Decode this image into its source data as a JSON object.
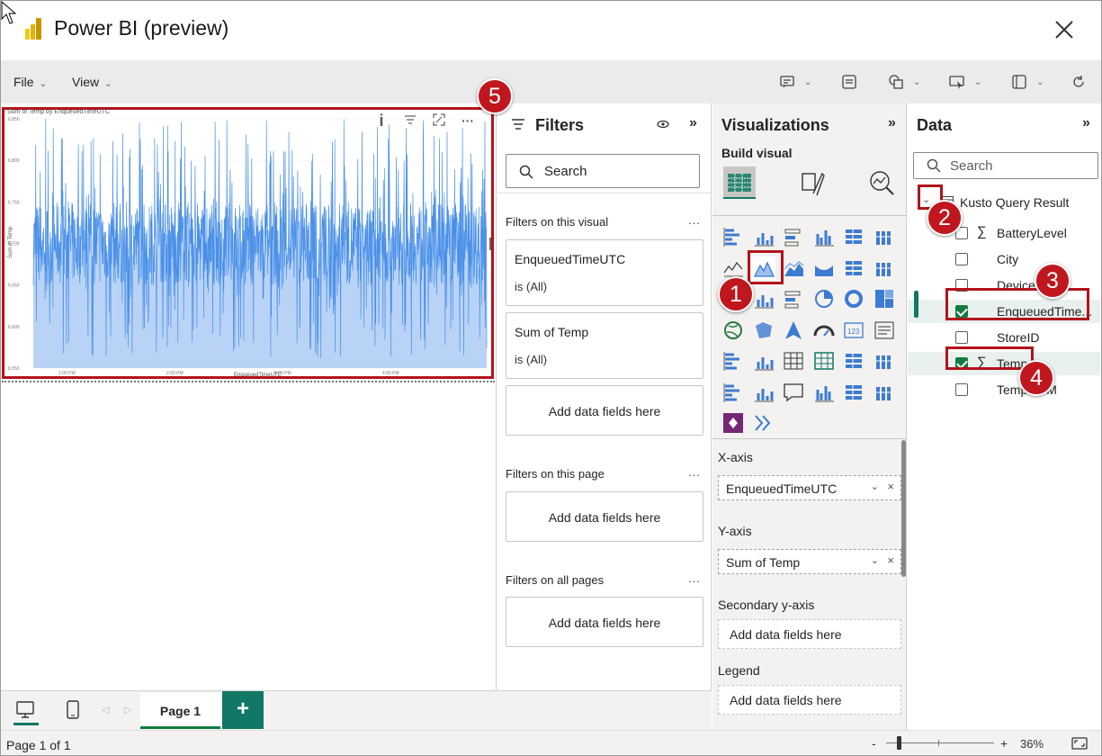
{
  "window": {
    "title": "Power BI (preview)"
  },
  "menu": {
    "file": "File",
    "view": "View"
  },
  "visual": {
    "title": "Sum of Temp by EnqueuedTimeUTC",
    "info_icon": "i",
    "more": "···"
  },
  "chart_data": {
    "type": "area",
    "title": "Sum of Temp by EnqueuedTimeUTC",
    "xlabel": "EnqueuedTimeUTC",
    "ylabel": "Sum of Temp",
    "x_ticks": [
      "1:00 PM",
      "2:00 PM",
      "3:00 PM",
      "4:00 PM"
    ],
    "y_ticks": [
      "6,550",
      "6,600",
      "6,650",
      "6,700",
      "6,750",
      "6,800",
      "6,850"
    ],
    "ylim": [
      6550,
      6850
    ],
    "series": [
      {
        "name": "Sum of Temp",
        "color": "#4a90e8",
        "fill": "#b9d3f6",
        "typical_range": [
          6650,
          6750
        ],
        "min": 6560,
        "max": 6850
      }
    ]
  },
  "filters": {
    "title": "Filters",
    "search_label": "Search",
    "on_visual": "Filters on this visual",
    "cards": [
      {
        "name": "EnqueuedTimeUTC",
        "state": "is (All)"
      },
      {
        "name": "Sum of Temp",
        "state": "is (All)"
      }
    ],
    "add_fields": "Add data fields here",
    "on_page": "Filters on this page",
    "on_all": "Filters on all pages",
    "more": "..."
  },
  "viz": {
    "title": "Visualizations",
    "build_visual": "Build visual",
    "x_axis": "X-axis",
    "x_field": "EnqueuedTimeUTC",
    "y_axis": "Y-axis",
    "y_field": "Sum of Temp",
    "secondary": "Secondary y-axis",
    "legend": "Legend",
    "add_fields": "Add data fields here"
  },
  "data": {
    "title": "Data",
    "search_placeholder": "Search",
    "table": "Kusto Query Result",
    "fields": [
      {
        "label": "BatteryLevel",
        "sigma": true,
        "checked": false
      },
      {
        "label": "City",
        "sigma": false,
        "checked": false
      },
      {
        "label": "DeviceID",
        "sigma": false,
        "checked": false
      },
      {
        "label": "EnqueuedTime...",
        "sigma": false,
        "checked": true
      },
      {
        "label": "StoreID",
        "sigma": false,
        "checked": false
      },
      {
        "label": "Temp",
        "sigma": true,
        "checked": true
      },
      {
        "label": "TempUOM",
        "sigma": false,
        "checked": false
      }
    ]
  },
  "badges": [
    "1",
    "2",
    "3",
    "4",
    "5"
  ],
  "pages": {
    "tab": "Page 1",
    "add": "+"
  },
  "status": {
    "page_of": "Page 1 of 1",
    "zoom": "36%",
    "zoom_minus": "-",
    "zoom_plus": "+"
  },
  "colors": {
    "accent": "#117865",
    "highlight": "#b3121b",
    "badge": "#c0161e"
  }
}
